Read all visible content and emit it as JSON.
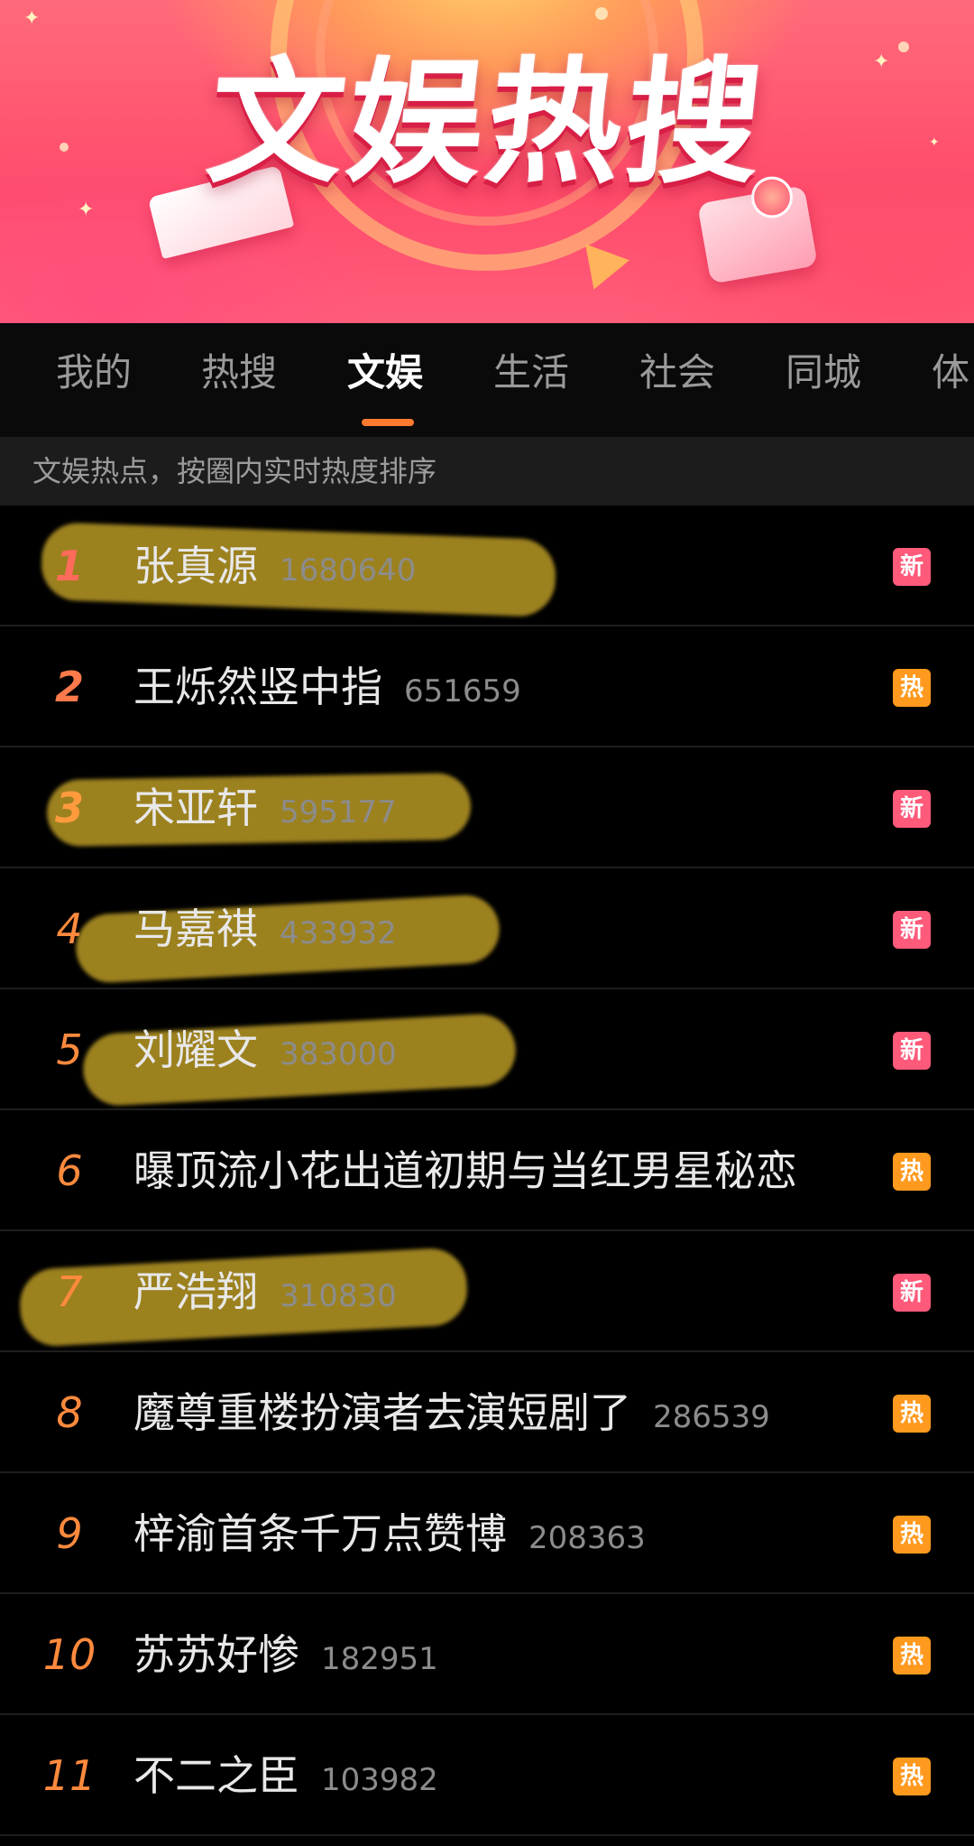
{
  "banner": {
    "title": "文娱热搜"
  },
  "tabs": [
    {
      "label": "我的",
      "active": false
    },
    {
      "label": "热搜",
      "active": false
    },
    {
      "label": "文娱",
      "active": true
    },
    {
      "label": "生活",
      "active": false
    },
    {
      "label": "社会",
      "active": false
    },
    {
      "label": "同城",
      "active": false
    },
    {
      "label": "体",
      "active": false
    }
  ],
  "subheader": "文娱热点，按圈内实时热度排序",
  "colors": {
    "accent": "#ff7a2f",
    "badge_new": "#ff5a7a",
    "badge_hot": "#ff9a1f",
    "highlight": "#c8a528"
  },
  "list": [
    {
      "rank": "1",
      "title": "张真源",
      "heat": "1680640",
      "badge": "新",
      "badge_type": "new",
      "highlighted": true
    },
    {
      "rank": "2",
      "title": "王烁然竖中指",
      "heat": "651659",
      "badge": "热",
      "badge_type": "hot",
      "highlighted": false
    },
    {
      "rank": "3",
      "title": "宋亚轩",
      "heat": "595177",
      "badge": "新",
      "badge_type": "new",
      "highlighted": true
    },
    {
      "rank": "4",
      "title": "马嘉祺",
      "heat": "433932",
      "badge": "新",
      "badge_type": "new",
      "highlighted": true
    },
    {
      "rank": "5",
      "title": "刘耀文",
      "heat": "383000",
      "badge": "新",
      "badge_type": "new",
      "highlighted": true
    },
    {
      "rank": "6",
      "title": "曝顶流小花出道初期与当红男星秘恋",
      "heat": "",
      "badge": "热",
      "badge_type": "hot",
      "highlighted": false
    },
    {
      "rank": "7",
      "title": "严浩翔",
      "heat": "310830",
      "badge": "新",
      "badge_type": "new",
      "highlighted": true
    },
    {
      "rank": "8",
      "title": "魔尊重楼扮演者去演短剧了",
      "heat": "286539",
      "badge": "热",
      "badge_type": "hot",
      "highlighted": false
    },
    {
      "rank": "9",
      "title": "梓渝首条千万点赞博",
      "heat": "208363",
      "badge": "热",
      "badge_type": "hot",
      "highlighted": false
    },
    {
      "rank": "10",
      "title": "苏苏好惨",
      "heat": "182951",
      "badge": "热",
      "badge_type": "hot",
      "highlighted": false
    },
    {
      "rank": "11",
      "title": "不二之臣",
      "heat": "103982",
      "badge": "热",
      "badge_type": "hot",
      "highlighted": false
    }
  ]
}
